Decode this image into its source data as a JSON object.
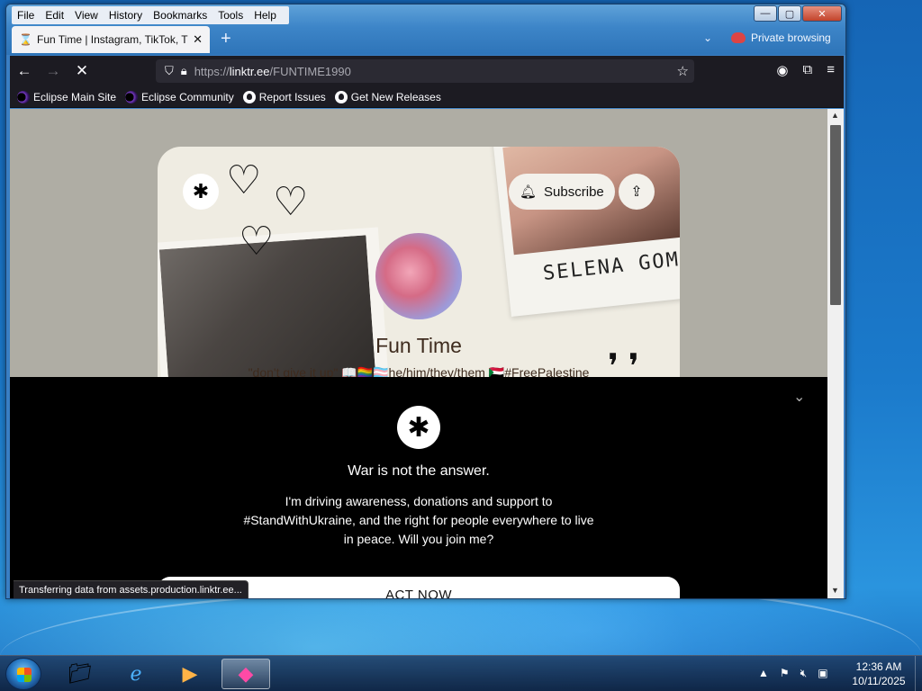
{
  "window": {
    "menu": [
      "File",
      "Edit",
      "View",
      "History",
      "Bookmarks",
      "Tools",
      "Help"
    ],
    "controls": {
      "minimize": "—",
      "maximize": "▢",
      "close": "✕"
    }
  },
  "tab": {
    "title": "Fun Time | Instagram, TikTok, T",
    "close_icon": "✕",
    "new_tab_icon": "+",
    "list_tabs_icon": "⌄"
  },
  "private_label": "Private browsing",
  "navbar": {
    "back": "←",
    "forward": "→",
    "stop": "✕",
    "url_scheme": "https://",
    "url_host": "linktr.ee",
    "url_path": "/FUNTIME1990",
    "star": "☆"
  },
  "bookmarks": [
    {
      "label": "Eclipse Main Site",
      "icon": "eclipse-icon"
    },
    {
      "label": "Eclipse Community",
      "icon": "eclipse-icon"
    },
    {
      "label": "Report Issues",
      "icon": "github-icon"
    },
    {
      "label": "Get New Releases",
      "icon": "github-icon"
    }
  ],
  "profile": {
    "subscribe_label": "Subscribe",
    "name": "Fun Time",
    "bio": "\"don't give it up\" 📖🏳️‍🌈🏳️‍⚧️he/him/they/them 🇸🇩#FreePalestine",
    "photo_caption": "SELENA GOM"
  },
  "overlay": {
    "heading": "War is not the answer.",
    "message": "I'm driving awareness, donations and support to #StandWithUkraine, and the right for people everywhere to live in peace. Will you join me?",
    "button": "ACT NOW"
  },
  "status_text": "Transferring data from assets.production.linktr.ee...",
  "taskbar": {
    "time": "12:36 AM",
    "date": "10/11/2025"
  },
  "colors": {
    "card_bg": "#efece2",
    "overlay_bg": "#000000",
    "toolbar_bg": "#1c1b22"
  }
}
